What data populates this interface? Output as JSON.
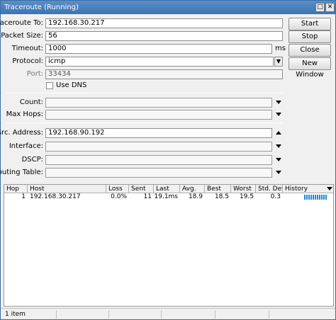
{
  "window": {
    "title": "Traceroute (Running)",
    "minimize_glyph": "□",
    "close_glyph": "✕"
  },
  "form": {
    "traceroute_to": {
      "label": "Traceroute To:",
      "value": "192.168.30.217"
    },
    "packet_size": {
      "label": "Packet Size:",
      "value": "56"
    },
    "timeout": {
      "label": "Timeout:",
      "value": "1000",
      "unit": "ms"
    },
    "protocol": {
      "label": "Protocol:",
      "value": "icmp"
    },
    "port": {
      "label": "Port:",
      "value": "33434"
    },
    "use_dns": {
      "label": "Use DNS",
      "checked": false
    },
    "count": {
      "label": "Count:",
      "value": ""
    },
    "max_hops": {
      "label": "Max Hops:",
      "value": ""
    },
    "src_address": {
      "label": "Src. Address:",
      "value": "192.168.90.192"
    },
    "interface": {
      "label": "Interface:",
      "value": ""
    },
    "dscp": {
      "label": "DSCP:",
      "value": ""
    },
    "routing_table": {
      "label": "Routing Table:",
      "value": ""
    }
  },
  "buttons": {
    "start": "Start",
    "stop": "Stop",
    "close": "Close",
    "new_window": "New Window"
  },
  "table": {
    "columns": [
      "Hop",
      "Host",
      "Loss",
      "Sent",
      "Last",
      "Avg.",
      "Best",
      "Worst",
      "Std. Dev.",
      "History"
    ],
    "rows": [
      {
        "hop": "1",
        "host": "192.168.30.217",
        "loss": "0.0%",
        "sent": "11",
        "last": "19.1ms",
        "avg": "18.9",
        "best": "18.5",
        "worst": "19.5",
        "std_dev": "0.3"
      }
    ]
  },
  "status": {
    "items_count": "1 item"
  },
  "colors": {
    "titlebar": "#3d73b3",
    "history_bar": "#1f8ad8"
  }
}
